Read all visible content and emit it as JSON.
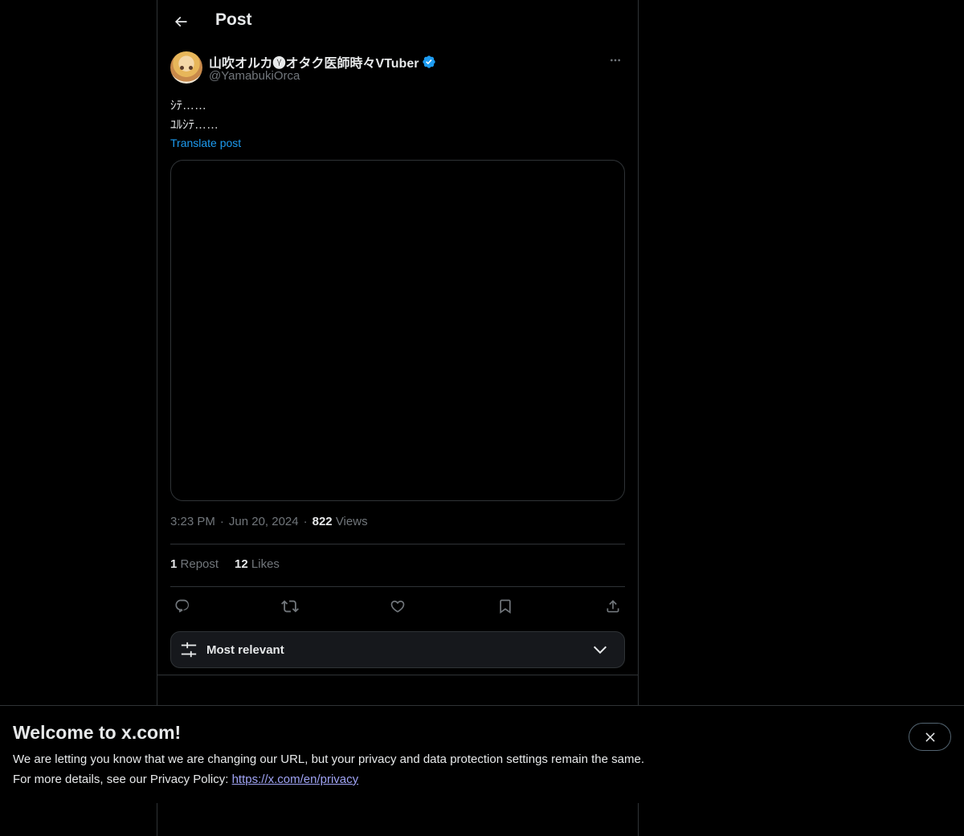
{
  "header": {
    "title": "Post",
    "back_icon": "arrow-left-icon"
  },
  "author": {
    "display_name": "山吹オルカ🅨オタク医師時々VTuber",
    "handle": "@YamabukiOrca",
    "verified_icon": "verified-badge-icon",
    "verified_color": "#1d9bf0",
    "more_icon": "more-horizontal-icon"
  },
  "post": {
    "text_lines": [
      "ｼﾃ……",
      "ﾕﾙｼﾃ……"
    ],
    "translate_label": "Translate post",
    "time": "3:23 PM",
    "date": "Jun 20, 2024",
    "views_count": "822",
    "views_label": "Views"
  },
  "stats": {
    "reposts_count": "1",
    "reposts_label": "Repost",
    "likes_count": "12",
    "likes_label": "Likes"
  },
  "actions": {
    "reply_icon": "reply-icon",
    "repost_icon": "repost-icon",
    "like_icon": "heart-icon",
    "bookmark_icon": "bookmark-icon",
    "share_icon": "share-icon"
  },
  "sort": {
    "label": "Most relevant",
    "icon": "sliders-icon",
    "chevron": "chevron-down-icon"
  },
  "banner": {
    "title": "Welcome to x.com!",
    "line1": "We are letting you know that we are changing our URL, but your privacy and data protection settings remain the same.",
    "line2_prefix": "For more details, see our Privacy Policy: ",
    "link_text": "https://x.com/en/privacy",
    "link_color": "#a0a4f5",
    "close_icon": "close-icon"
  },
  "colors": {
    "background": "#000000",
    "text": "#e7e9ea",
    "muted": "#71767b",
    "accent": "#1d9bf0",
    "border": "#2f3336"
  }
}
